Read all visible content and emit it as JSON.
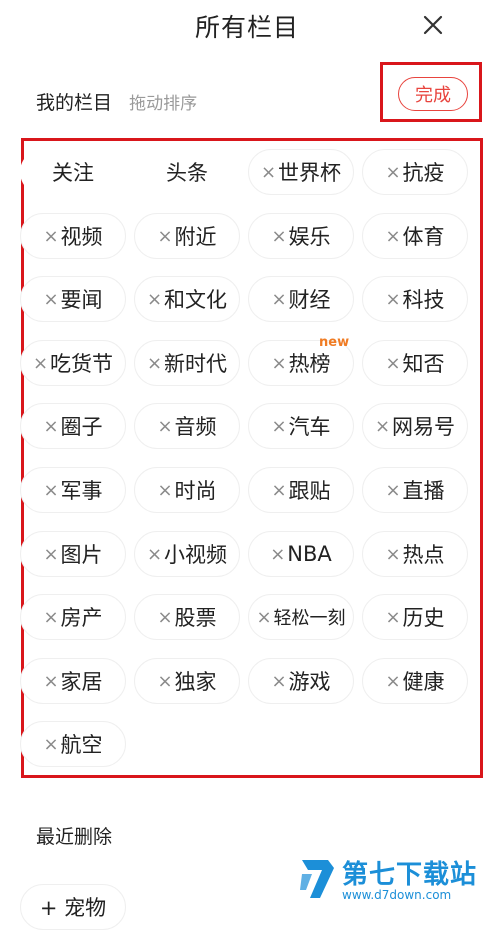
{
  "header": {
    "title": "所有栏目"
  },
  "my_channels": {
    "title": "我的栏目",
    "hint": "拖动排序",
    "done_label": "完成",
    "remove_glyph": "×",
    "new_badge": "new",
    "items": [
      {
        "label": "关注",
        "removable": false
      },
      {
        "label": "头条",
        "removable": false
      },
      {
        "label": "世界杯",
        "removable": true
      },
      {
        "label": "抗疫",
        "removable": true
      },
      {
        "label": "视频",
        "removable": true
      },
      {
        "label": "附近",
        "removable": true
      },
      {
        "label": "娱乐",
        "removable": true
      },
      {
        "label": "体育",
        "removable": true
      },
      {
        "label": "要闻",
        "removable": true
      },
      {
        "label": "和文化",
        "removable": true
      },
      {
        "label": "财经",
        "removable": true
      },
      {
        "label": "科技",
        "removable": true
      },
      {
        "label": "吃货节",
        "removable": true
      },
      {
        "label": "新时代",
        "removable": true
      },
      {
        "label": "热榜",
        "removable": true,
        "is_new": true
      },
      {
        "label": "知否",
        "removable": true
      },
      {
        "label": "圈子",
        "removable": true
      },
      {
        "label": "音频",
        "removable": true
      },
      {
        "label": "汽车",
        "removable": true
      },
      {
        "label": "网易号",
        "removable": true
      },
      {
        "label": "军事",
        "removable": true
      },
      {
        "label": "时尚",
        "removable": true
      },
      {
        "label": "跟贴",
        "removable": true
      },
      {
        "label": "直播",
        "removable": true
      },
      {
        "label": "图片",
        "removable": true
      },
      {
        "label": "小视频",
        "removable": true
      },
      {
        "label": "NBA",
        "removable": true
      },
      {
        "label": "热点",
        "removable": true
      },
      {
        "label": "房产",
        "removable": true
      },
      {
        "label": "股票",
        "removable": true
      },
      {
        "label": "轻松一刻",
        "removable": true
      },
      {
        "label": "历史",
        "removable": true
      },
      {
        "label": "家居",
        "removable": true
      },
      {
        "label": "独家",
        "removable": true
      },
      {
        "label": "游戏",
        "removable": true
      },
      {
        "label": "健康",
        "removable": true
      },
      {
        "label": "航空",
        "removable": true
      }
    ]
  },
  "recent_deleted": {
    "title": "最近删除",
    "partial_item": "+ 宠物"
  },
  "watermark": {
    "brand": "第七下载站",
    "url": "www.d7down.com"
  },
  "colors": {
    "accent": "#e8443e",
    "highlight_frame": "#d9161b",
    "watermark": "#1c8fd8"
  }
}
